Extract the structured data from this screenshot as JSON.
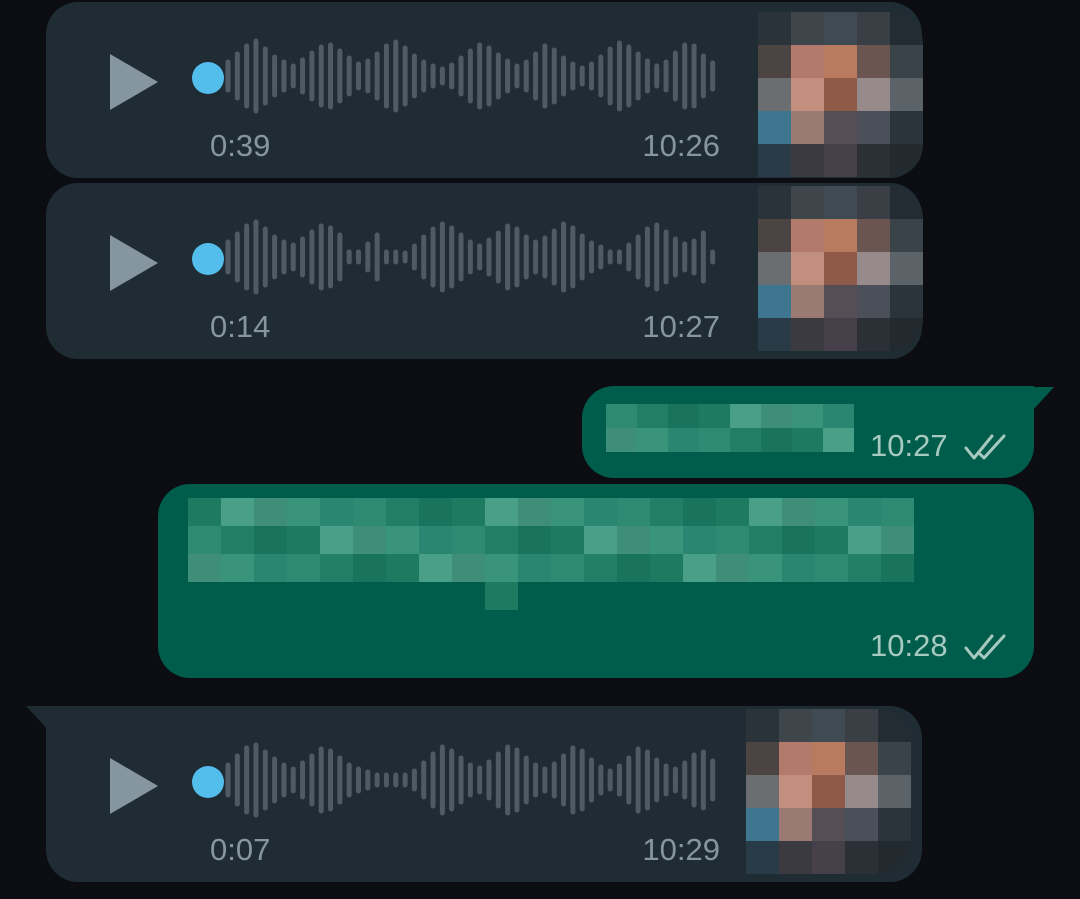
{
  "colors": {
    "background": "#0b0d12",
    "incoming_bubble": "#1f2c34",
    "outgoing_bubble": "#005c4b",
    "accent_dot": "#53bdeb",
    "meta_text": "#8696a0",
    "wave": "#4e5b63"
  },
  "messages": [
    {
      "type": "voice",
      "direction": "incoming",
      "duration": "0:39",
      "time": "10:26",
      "play_icon": "play-icon",
      "avatar": "pixelated-profile-photo"
    },
    {
      "type": "voice",
      "direction": "incoming",
      "duration": "0:14",
      "time": "10:27",
      "play_icon": "play-icon",
      "avatar": "pixelated-profile-photo"
    },
    {
      "type": "text",
      "direction": "outgoing",
      "content": "pixelated-text",
      "time": "10:27",
      "status_icon": "double-check-icon"
    },
    {
      "type": "text",
      "direction": "outgoing",
      "content": "pixelated-text",
      "time": "10:28",
      "status_icon": "double-check-icon"
    },
    {
      "type": "voice",
      "direction": "incoming",
      "duration": "0:07",
      "time": "10:29",
      "play_icon": "play-icon",
      "avatar": "pixelated-profile-photo"
    }
  ]
}
